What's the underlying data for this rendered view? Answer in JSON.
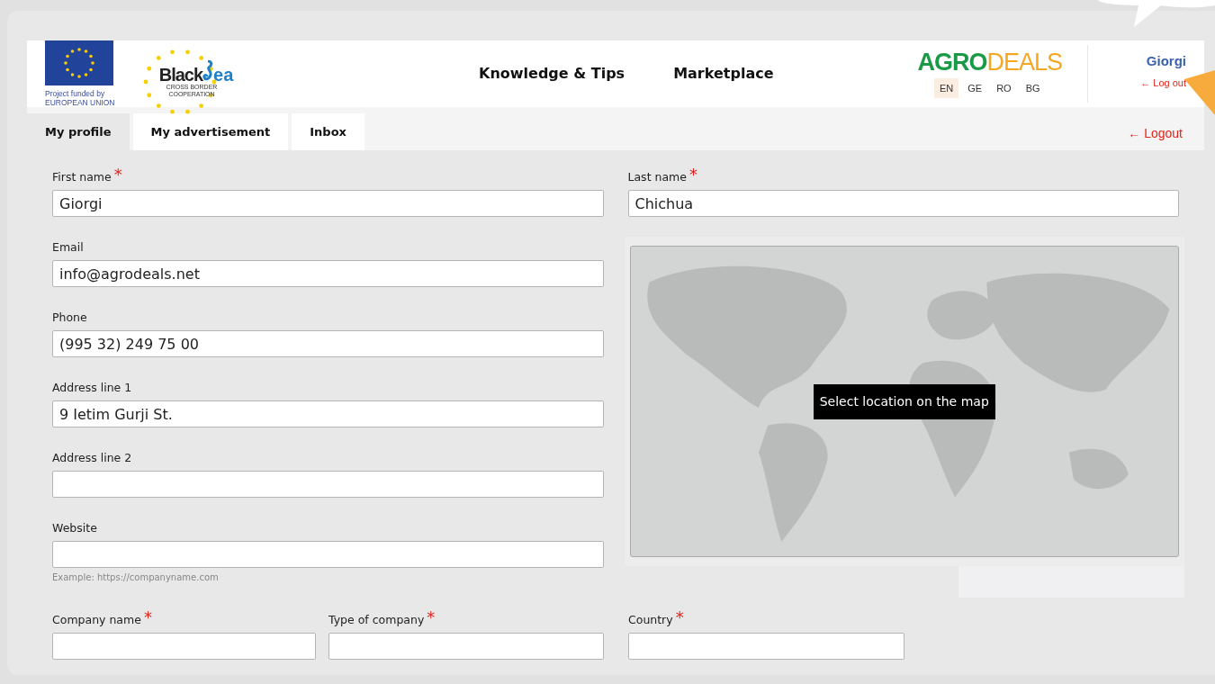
{
  "header": {
    "eu_logo": {
      "line_1": "Project funded by",
      "line_2": "EUROPEAN UNION"
    },
    "blacksea_logo": {
      "word_1": "Black",
      "word_2": "ea",
      "subtitle_1": "CROSS BORDER",
      "subtitle_2": "COOPERATION"
    },
    "nav": [
      "Knowledge & Tips",
      "Marketplace"
    ],
    "brand": {
      "part_1": "AGRO",
      "part_2": "DEALS"
    },
    "languages": [
      {
        "label": "EN",
        "selected": true
      },
      {
        "label": "GE",
        "selected": false
      },
      {
        "label": "RO",
        "selected": false
      },
      {
        "label": "BG",
        "selected": false
      }
    ],
    "user": {
      "name": "Giorgi",
      "logout": "← Log out"
    }
  },
  "tabs": [
    {
      "label": "My profile",
      "selected": true
    },
    {
      "label": "My advertisement",
      "selected": false
    },
    {
      "label": "Inbox",
      "selected": false
    }
  ],
  "logout": "← Logout",
  "left_fields": [
    {
      "label": "First name",
      "required_mark": "*",
      "value": "Giorgi"
    },
    {
      "label": "Email",
      "value": "info@agrodeals.net"
    },
    {
      "label": "Phone",
      "value": "(995 32) 249 75 00"
    },
    {
      "label": "Address line 1",
      "value": "9 Ietim Gurji St."
    },
    {
      "label": "Address line 2"
    },
    {
      "label": "Website",
      "hint": "Example: https://companyname.com"
    }
  ],
  "right_field": {
    "label": "Last name",
    "required_mark": "*",
    "value": "Chichua"
  },
  "map": {
    "label": "Select location on the map"
  },
  "bottom_fields": [
    {
      "label": "Company name",
      "required_mark": "*"
    },
    {
      "label": "Type of company",
      "required_mark": "*"
    },
    {
      "label": "Country",
      "required_mark": "*"
    }
  ]
}
